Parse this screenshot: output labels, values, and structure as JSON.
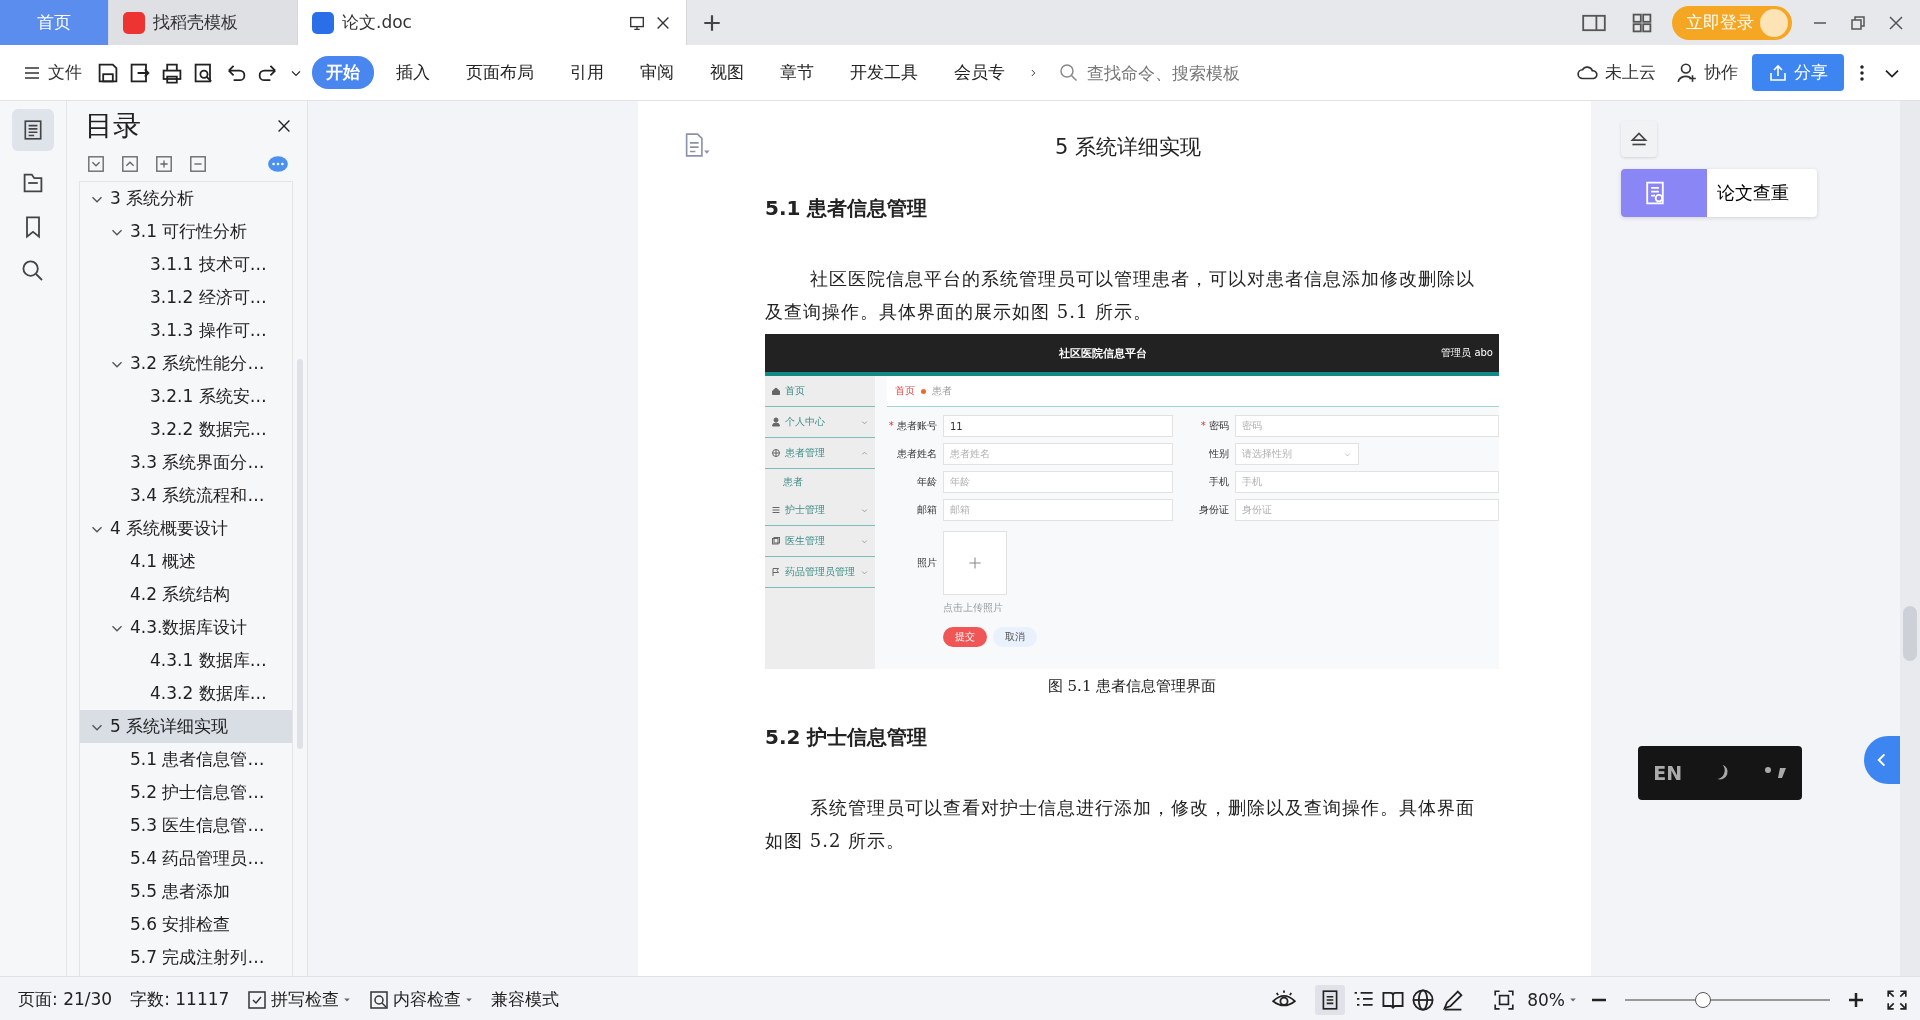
{
  "tabs": [
    {
      "label": "首页",
      "selected": false,
      "kind": "home"
    },
    {
      "label": "找稻壳模板",
      "selected": false,
      "kind": "web"
    },
    {
      "label": "论文.doc",
      "selected": true,
      "kind": "doc"
    }
  ],
  "account": {
    "login": "立即登录"
  },
  "toolbar": {
    "file": "文件",
    "ribbon_tabs": [
      {
        "label": "开始",
        "selected": true
      },
      {
        "label": "插入",
        "selected": false
      },
      {
        "label": "页面布局",
        "selected": false
      },
      {
        "label": "引用",
        "selected": false
      },
      {
        "label": "审阅",
        "selected": false
      },
      {
        "label": "视图",
        "selected": false
      },
      {
        "label": "章节",
        "selected": false
      },
      {
        "label": "开发工具",
        "selected": false
      },
      {
        "label": "会员专",
        "selected": false
      }
    ],
    "search": {
      "placeholder": "查找命令、搜索模板"
    },
    "cloud": "未上云",
    "collab": "协作",
    "share": "分享"
  },
  "toc": {
    "title": "目录",
    "items": [
      {
        "label": "3 系统分析",
        "selected": false,
        "expanded": true,
        "children": [
          {
            "label": "3.1 可行性分析",
            "selected": false,
            "expanded": true,
            "children": [
              {
                "label": "3.1.1 技术可…",
                "selected": false
              },
              {
                "label": "3.1.2 经济可…",
                "selected": false
              },
              {
                "label": "3.1.3 操作可…",
                "selected": false
              }
            ]
          },
          {
            "label": "3.2 系统性能分…",
            "selected": false,
            "expanded": true,
            "children": [
              {
                "label": "3.2.1  系统安…",
                "selected": false
              },
              {
                "label": "3.2.2  数据完…",
                "selected": false
              }
            ]
          },
          {
            "label": "3.3 系统界面分…",
            "selected": false
          },
          {
            "label": "3.4 系统流程和…",
            "selected": false
          }
        ]
      },
      {
        "label": "4 系统概要设计",
        "selected": false,
        "expanded": true,
        "children": [
          {
            "label": "4.1 概述",
            "selected": false
          },
          {
            "label": "4.2 系统结构",
            "selected": false
          },
          {
            "label": "4.3.数据库设计",
            "selected": false,
            "expanded": true,
            "children": [
              {
                "label": "4.3.1 数据库…",
                "selected": false
              },
              {
                "label": "4.3.2 数据库…",
                "selected": false
              }
            ]
          }
        ]
      },
      {
        "label": "5 系统详细实现",
        "selected": true,
        "expanded": true,
        "children": [
          {
            "label": "5.1  患者信息管…",
            "selected": false
          },
          {
            "label": "5.2  护士信息管…",
            "selected": false
          },
          {
            "label": "5.3  医生信息管…",
            "selected": false
          },
          {
            "label": "5.4  药品管理员…",
            "selected": false
          },
          {
            "label": "5.5  患者添加",
            "selected": false
          },
          {
            "label": "5.6  安排检查",
            "selected": false
          },
          {
            "label": "5.7  完成注射列…",
            "selected": false
          }
        ]
      }
    ]
  },
  "document": {
    "heading": "5 系统详细实现",
    "sections": [
      {
        "title": "5.1  患者信息管理",
        "paragraph": "社区医院信息平台的系统管理员可以管理患者，可以对患者信息添加修改删除以及查询操作。具体界面的展示如图 5.1 所示。",
        "figure": {
          "app_title": "社区医院信息平台",
          "user": "管理员 abo",
          "menu": [
            {
              "label": "首页"
            },
            {
              "label": "个人中心",
              "expanded": false
            },
            {
              "label": "患者管理",
              "expanded": true,
              "children": [
                {
                  "label": "患者"
                }
              ]
            },
            {
              "label": "护士管理",
              "expanded": false
            },
            {
              "label": "医生管理",
              "expanded": false
            },
            {
              "label": "药品管理员管理",
              "expanded": false
            }
          ],
          "breadcrumb": [
            "首页",
            "患者"
          ],
          "fields": [
            {
              "label": "患者账号",
              "required_mark": "*",
              "kind": "text",
              "value": "11"
            },
            {
              "label": "密码",
              "required_mark": "*",
              "kind": "text",
              "placeholder": "密码"
            },
            {
              "label": "患者姓名",
              "kind": "text",
              "placeholder": "患者姓名"
            },
            {
              "label": "性别",
              "kind": "select",
              "placeholder": "请选择性别"
            },
            {
              "label": "年龄",
              "kind": "text",
              "placeholder": "年龄"
            },
            {
              "label": "手机",
              "kind": "text",
              "placeholder": "手机"
            },
            {
              "label": "邮箱",
              "kind": "text",
              "placeholder": "邮箱"
            },
            {
              "label": "身份证",
              "kind": "text",
              "placeholder": "身份证"
            }
          ],
          "upload": {
            "label": "照片",
            "hint": "点击上传照片"
          },
          "buttons": [
            {
              "label": "提交",
              "kind": "primary"
            },
            {
              "label": "取消",
              "kind": "secondary"
            }
          ],
          "caption": "图 5.1  患者信息管理界面"
        }
      },
      {
        "title": "5.2  护士信息管理",
        "paragraph": "系统管理员可以查看对护士信息进行添加，修改，删除以及查询操作。具体界面如图 5.2 所示。"
      }
    ]
  },
  "side_panel": {
    "check_button": "论文查重"
  },
  "ime": {
    "mode": "EN"
  },
  "status_bar": {
    "page": "页面: 21/30",
    "words": "字数: 11117",
    "spell": "拼写检查",
    "content": "内容检查",
    "mode": "兼容模式",
    "zoom": "80%",
    "zoom_slider": {
      "level": 0.38
    }
  }
}
